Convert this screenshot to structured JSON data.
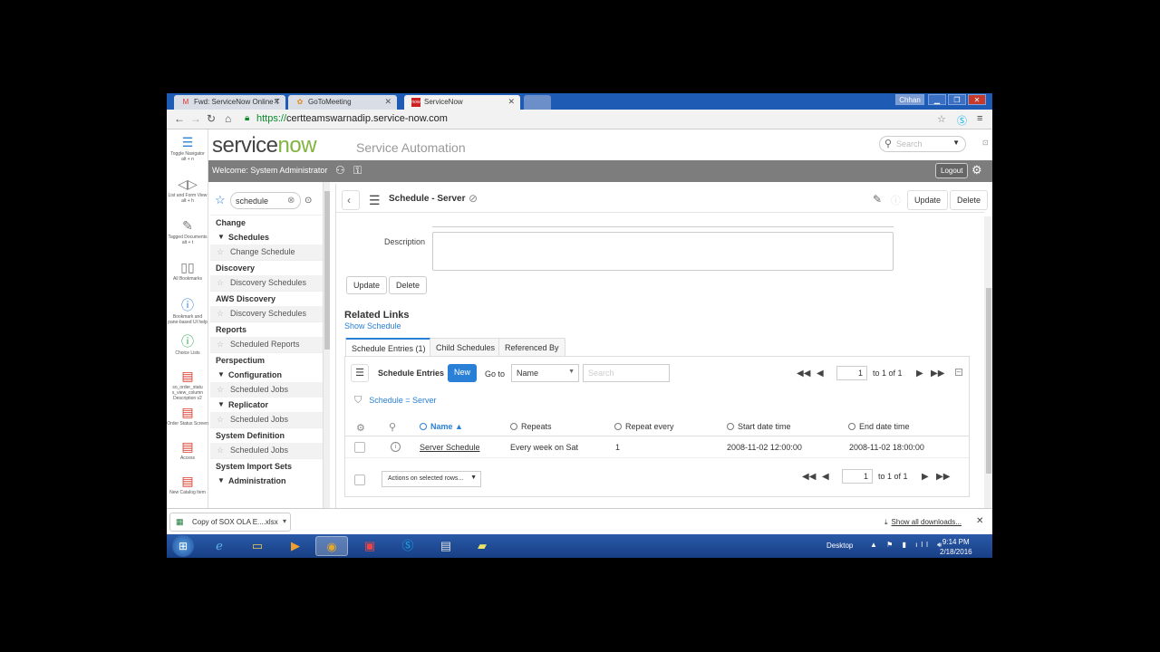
{
  "browser": {
    "tabs": [
      {
        "label": "Fwd: ServiceNow Online T",
        "icon": "gmail-icon"
      },
      {
        "label": "GoToMeeting",
        "icon": "gotomeeting-icon"
      },
      {
        "label": "ServiceNow",
        "icon": "servicenow-icon"
      }
    ],
    "user_badge": "Chhan",
    "url_scheme": "https://",
    "url_host": "certteamswarnadip.service-now.com"
  },
  "app": {
    "logo_main": "service",
    "logo_accent": "now",
    "subtitle": "Service Automation",
    "search_placeholder": "Search",
    "welcome": "Welcome:  System Administrator",
    "logout": "Logout"
  },
  "navtools": [
    {
      "icon": "toggle-navigator-icon",
      "label": "Toggle Navigator",
      "shortcut": "alt + n"
    },
    {
      "icon": "list-form-view-icon",
      "label": "List and Form View",
      "shortcut": "alt + h"
    },
    {
      "icon": "tagged-documents-icon",
      "label": "Tagged Documents",
      "shortcut": "alt + t"
    },
    {
      "icon": "bookmarks-icon",
      "label": "All Bookmarks"
    },
    {
      "icon": "help-icon",
      "label": "Bookmark and pane-based UI help"
    },
    {
      "icon": "choice-lists-icon",
      "label": "Choice Lists"
    },
    {
      "icon": "report-icon",
      "label": "so_order_statu s_view_column Description v2"
    },
    {
      "icon": "report-icon",
      "label": "Order Status Screen"
    },
    {
      "icon": "report-icon",
      "label": "Access"
    },
    {
      "icon": "report-icon",
      "label": "New Catalog Item"
    }
  ],
  "navigator": {
    "filter_value": "schedule",
    "items": [
      {
        "type": "app",
        "label": "Change"
      },
      {
        "type": "sec",
        "label": "Schedules"
      },
      {
        "type": "mod",
        "label": "Change Schedule"
      },
      {
        "type": "app",
        "label": "Discovery"
      },
      {
        "type": "mod",
        "label": "Discovery Schedules"
      },
      {
        "type": "app",
        "label": "AWS Discovery"
      },
      {
        "type": "mod",
        "label": "Discovery Schedules"
      },
      {
        "type": "app",
        "label": "Reports"
      },
      {
        "type": "mod",
        "label": "Scheduled Reports"
      },
      {
        "type": "app",
        "label": "Perspectium"
      },
      {
        "type": "sec",
        "label": "Configuration"
      },
      {
        "type": "mod",
        "label": "Scheduled Jobs"
      },
      {
        "type": "sec",
        "label": "Replicator"
      },
      {
        "type": "mod",
        "label": "Scheduled Jobs"
      },
      {
        "type": "app",
        "label": "System Definition"
      },
      {
        "type": "mod",
        "label": "Scheduled Jobs"
      },
      {
        "type": "app",
        "label": "System Import Sets"
      },
      {
        "type": "sec",
        "label": "Administration"
      }
    ]
  },
  "form": {
    "title": "Schedule - Server",
    "update": "Update",
    "delete": "Delete",
    "description_label": "Description",
    "description_value": "",
    "related_links": "Related Links",
    "show_schedule": "Show Schedule"
  },
  "related_tabs": [
    "Schedule Entries (1)",
    "Child Schedules",
    "Referenced By"
  ],
  "related_list": {
    "title": "Schedule Entries",
    "new": "New",
    "goto_label": "Go to",
    "goto_field": "Name",
    "search_placeholder": "Search",
    "page": "1",
    "page_of": "to 1 of 1",
    "filter": "Schedule = Server",
    "columns": [
      "Name ▲",
      "Repeats",
      "Repeat every",
      "Start date time",
      "End date time"
    ],
    "rows": [
      {
        "name": "Server Schedule",
        "repeats": "Every week on Sat",
        "repeat_every": "1",
        "start": "2008-11-02 12:00:00",
        "end": "2008-11-02 18:00:00"
      }
    ],
    "actions": "Actions on selected rows..."
  },
  "downloads": {
    "file": "Copy of SOX OLA E....xlsx",
    "show_all": "Show all downloads..."
  },
  "taskbar": {
    "desktop": "Desktop",
    "time": "9:14 PM",
    "date": "2/18/2016"
  },
  "colors": {
    "accent_blue": "#2a7fd6",
    "brand_green": "#81b441",
    "header_gray": "#7d7d7d",
    "taskbar_blue": "#1e5bb5"
  }
}
